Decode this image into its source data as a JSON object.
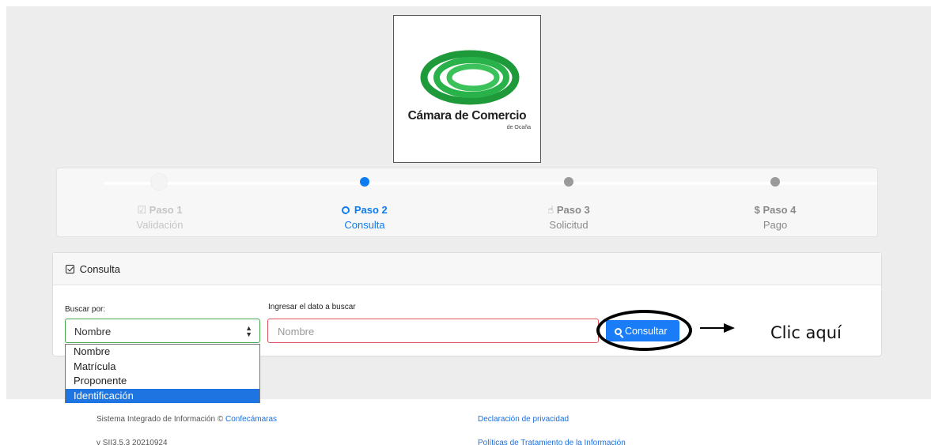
{
  "logo": {
    "title": "Cámara de Comercio",
    "subtitle": "de Ocaña"
  },
  "steps": [
    {
      "title": "Paso 1",
      "subtitle": "Validación",
      "icon": "check-square-icon",
      "state": "done"
    },
    {
      "title": "Paso 2",
      "subtitle": "Consulta",
      "icon": "search-icon",
      "state": "active"
    },
    {
      "title": "Paso 3",
      "subtitle": "Solicitud",
      "icon": "hand-pointer-icon",
      "state": "pending"
    },
    {
      "title": "Paso 4",
      "subtitle": "Pago",
      "icon": "dollar-icon",
      "state": "pending"
    }
  ],
  "consulta": {
    "header": "Consulta",
    "search_by_label": "Buscar por:",
    "search_by_value": "Nombre",
    "input_label": "Ingresar el dato a buscar",
    "input_placeholder": "Nombre",
    "button_label": "Consultar",
    "options": [
      "Nombre",
      "Matrícula",
      "Proponente",
      "Identificación"
    ],
    "highlighted_option": "Identificación"
  },
  "annotation": {
    "text": "Clic aquí"
  },
  "footer": {
    "system_text": "Sistema Integrado de Información ©",
    "system_link": "Confecámaras",
    "version": "v SII3.5.3 20210924",
    "privacy_link": "Declaración de privacidad",
    "policy_link": "Políticas de Tratamiento de la Información"
  },
  "colors": {
    "accent": "#0d7cf2",
    "button": "#1a7df7",
    "valid_border": "#45a84e",
    "invalid_border": "#e0515d",
    "logo_green": "#1f9a3a"
  }
}
